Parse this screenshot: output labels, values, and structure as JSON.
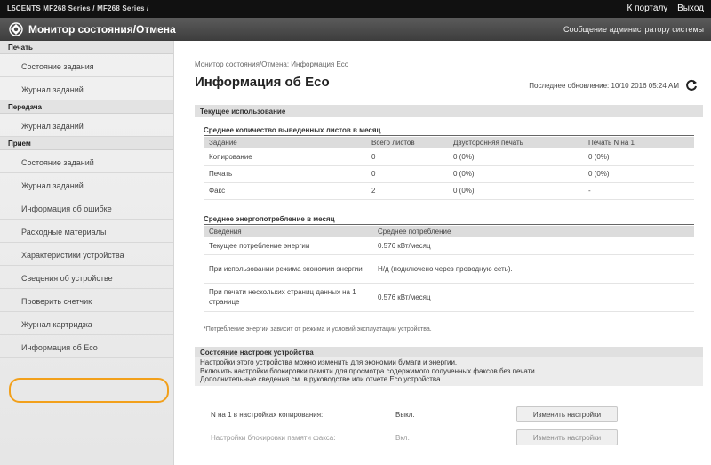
{
  "header": {
    "device": "L5CENTS      MF268 Series / MF268 Series /",
    "portal_link": "К порталу",
    "logout_link": "Выход",
    "app_title": "Монитор состояния/Отмена",
    "admin_message": "Сообщение администратору системы"
  },
  "sidebar": {
    "sections": [
      {
        "title": "Печать",
        "items": [
          "Состояние задания",
          "Журнал заданий"
        ]
      },
      {
        "title": "Передача",
        "items": [
          "Журнал заданий"
        ]
      },
      {
        "title": "Прием",
        "items": [
          "Состояние заданий",
          "Журнал заданий"
        ]
      }
    ],
    "device_items": [
      "Информация об ошибке",
      "Расходные материалы",
      "Характеристики устройства",
      "Сведения об устройстве",
      "Проверить счетчик",
      "Журнал картриджа",
      "Информация об Eco"
    ],
    "active_item": "Информация об Eco"
  },
  "main": {
    "breadcrumb": "Монитор состояния/Отмена: Информация Eco",
    "title": "Информация об Eco",
    "last_update": "Последнее обновление: 10/10 2016 05:24 AM",
    "current_usage": "Текущее использование",
    "sheets": {
      "title": "Среднее количество выведенных листов в месяц",
      "headers": [
        "Задание",
        "Всего листов",
        "Двусторонняя печать",
        "Печать N на 1"
      ],
      "rows": [
        [
          "Копирование",
          "0",
          "0 (0%)",
          "0 (0%)"
        ],
        [
          "Печать",
          "0",
          "0 (0%)",
          "0 (0%)"
        ],
        [
          "Факс",
          "2",
          "0 (0%)",
          "-"
        ]
      ]
    },
    "energy": {
      "title": "Среднее энергопотребление в месяц",
      "headers": [
        "Сведения",
        "Среднее потребление"
      ],
      "rows": [
        [
          "Текущее потребление энергии",
          "0.576 кВт/месяц"
        ],
        [
          "При использовании режима экономии энергии",
          "Н/д (подключено через проводную сеть)."
        ],
        [
          "При печати нескольких страниц данных на 1 странице",
          "0.576 кВт/месяц"
        ]
      ],
      "note": "*Потребление энергии зависит от режима и условий эксплуатации устройства."
    },
    "settings": {
      "title": "Состояние настроек устройства",
      "desc": [
        "Настройки этого устройства можно изменить для экономии бумаги и энергии.",
        "Включить настройки блокировки памяти для просмотра содержимого полученных факсов без печати.",
        "Дополнительные сведения см. в руководстве или отчете Eco устройства."
      ],
      "rows": [
        {
          "label": "N на 1 в настройках копирования:",
          "value": "Выкл.",
          "button": "Изменить настройки"
        },
        {
          "label": "Настройки блокировки памяти факса:",
          "value": "Вкл.",
          "button": "Изменить настройки"
        }
      ]
    }
  },
  "colors": {
    "highlight": "#f2a01b",
    "topbar": "#111111",
    "titlebar": "#4a4a4a"
  }
}
